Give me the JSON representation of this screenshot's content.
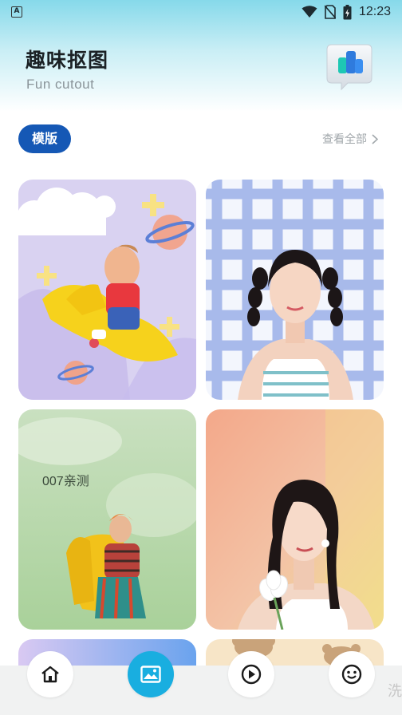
{
  "status_bar": {
    "left_icon": "A",
    "time": "12:23",
    "icons": [
      "wifi-icon",
      "no-sim-icon",
      "battery-icon"
    ]
  },
  "header": {
    "title": "趣味抠图",
    "subtitle": "Fun cutout",
    "badge_icon": "chart-bubble-icon"
  },
  "section": {
    "tab_label": "模版",
    "view_all": "查看全部",
    "view_all_icon": "chevron-right-icon"
  },
  "templates": [
    {
      "theme": "toddler-rocking-horse-clouds-planets",
      "label": ""
    },
    {
      "theme": "pigtails-girl-blue-plaid",
      "label": ""
    },
    {
      "theme": "woman-yellow-chair-green-smoke",
      "label": "007亲测"
    },
    {
      "theme": "woman-with-flower-gradient",
      "label": ""
    },
    {
      "theme": "purple-gradient",
      "label": ""
    },
    {
      "theme": "bear-pattern",
      "label": ""
    }
  ],
  "bottom_nav": [
    {
      "name": "home",
      "icon": "home-icon",
      "active": false
    },
    {
      "name": "image",
      "icon": "image-icon",
      "active": true
    },
    {
      "name": "video",
      "icon": "play-icon",
      "active": false
    },
    {
      "name": "sticker",
      "icon": "smiley-icon",
      "active": false
    }
  ],
  "corner_glyph": "洗",
  "colors": {
    "accent": "#1558b5",
    "nav_active": "#19aee0",
    "hero_top": "#86d9ea"
  }
}
